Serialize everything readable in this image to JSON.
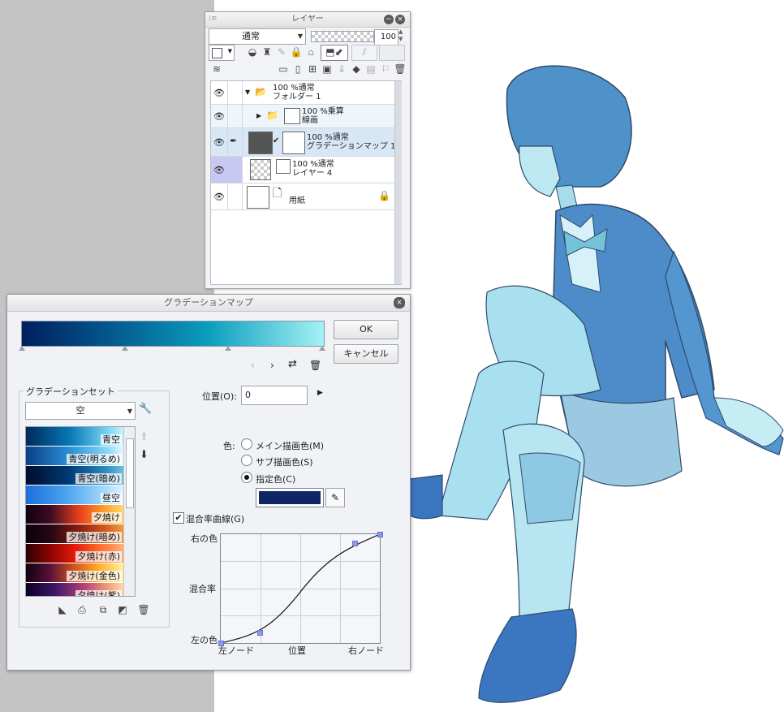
{
  "layer_panel": {
    "title": "レイヤー",
    "blend_mode": "通常",
    "opacity": "100",
    "layers": [
      {
        "name_line1": "100 %通常",
        "name_line2": "フォルダー 1"
      },
      {
        "name_line1": "100 %乗算",
        "name_line2": "線画"
      },
      {
        "name_line1": "100 %通常",
        "name_line2": "グラデーションマップ 1"
      },
      {
        "name_line1": "100 %通常",
        "name_line2": "レイヤー 4"
      },
      {
        "name_line1": "",
        "name_line2": "用紙"
      }
    ]
  },
  "gradient_map": {
    "title": "グラデーションマップ",
    "ok_label": "OK",
    "cancel_label": "キャンセル",
    "gradient_set_label": "グラデーションセット",
    "set_name": "空",
    "presets": [
      {
        "label": "青空",
        "gradient": "linear-gradient(to right,#002a5c,#0877b4 45%,#79d8f5 85%,#c9f2fb)"
      },
      {
        "label": "青空(明るめ)",
        "gradient": "linear-gradient(to right,#0a3f86,#2a8fd6 45%,#8fd9f7 85%,#e8f9fe)"
      },
      {
        "label": "青空(暗め)",
        "gradient": "linear-gradient(to right,#000a2a,#003b78 45%,#2c86b8 80%,#6bbfdc)"
      },
      {
        "label": "昼空",
        "gradient": "linear-gradient(to right,#1c6fd8,#47a2ee 40%,#a4d8fb 80%,#e0f2ff)"
      },
      {
        "label": "夕焼け",
        "gradient": "linear-gradient(to right,#120010,#3c0b22 25%,#e8401a 55%,#ff9d2a 80%,#ffd86a)"
      },
      {
        "label": "夕焼け(暗め)",
        "gradient": "linear-gradient(to right,#0b0008,#250614 25%,#8a1e10 55%,#d0561c 80%,#f19b40)"
      },
      {
        "label": "夕焼け(赤)",
        "gradient": "linear-gradient(to right,#2a0000,#8e0402 25%,#e11a0a 50%,#ff6b2a 75%,#ffb079)"
      },
      {
        "label": "夕焼け(金色)",
        "gradient": "linear-gradient(to right,#100010,#5a1238 25%,#d2561a 50%,#ffb02a 75%,#fff2a0)"
      },
      {
        "label": "夕焼け(紫)",
        "gradient": "linear-gradient(to right,#0b0026,#3d1766 30%,#b8407a 60%,#f4a07a 85%,#ffd7a8)"
      }
    ],
    "position_label": "位置(O):",
    "position_value": "0",
    "color_label": "色:",
    "radio_main": "メイン描画色(M)",
    "radio_sub": "サブ描画色(S)",
    "radio_specified": "指定色(C)",
    "specified_color": "#0f2565",
    "curve_checkbox_label": "混合率曲線(G)",
    "graph_right_color": "右の色",
    "graph_mix_rate": "混合率",
    "graph_left_color": "左の色",
    "graph_left_node": "左ノード",
    "graph_position": "位置",
    "graph_right_node": "右ノード"
  },
  "colors": {
    "accent_blue": "#0f2565",
    "gradient_start": "#001f5e",
    "gradient_end": "#a5f2f5"
  }
}
